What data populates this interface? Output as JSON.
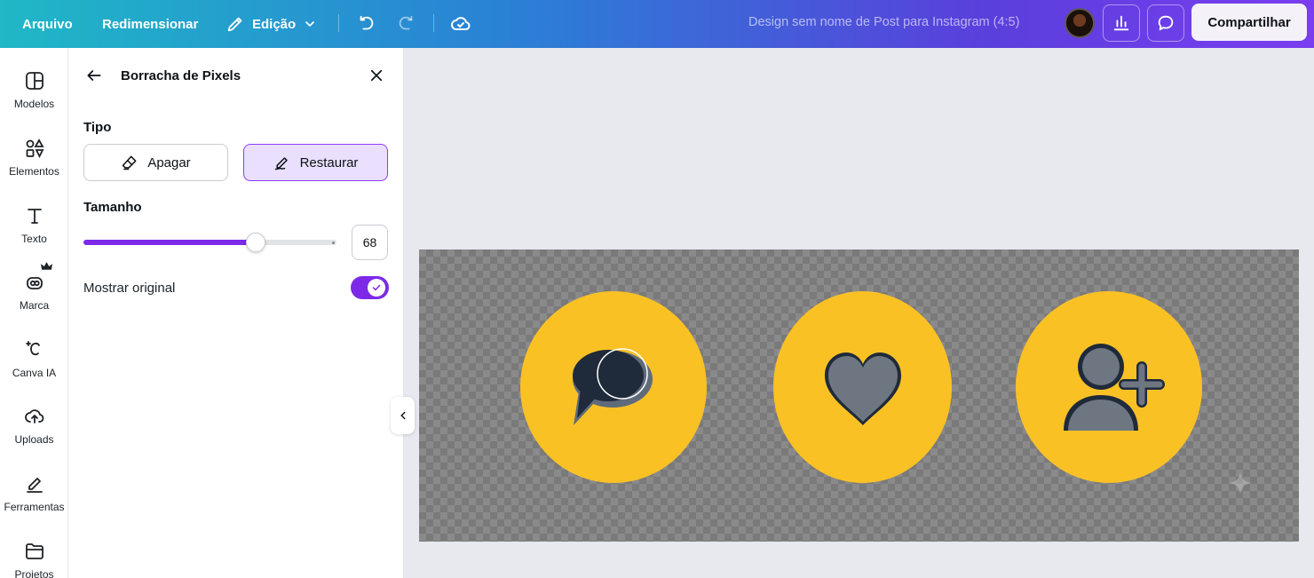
{
  "topbar": {
    "arquivo": "Arquivo",
    "redimensionar": "Redimensionar",
    "edicao": "Edição",
    "design_title": "Design sem nome de Post para Instagram (4:5)",
    "share": "Compartilhar"
  },
  "rail": {
    "items": [
      {
        "label": "Modelos",
        "icon": "templates-icon"
      },
      {
        "label": "Elementos",
        "icon": "elements-icon"
      },
      {
        "label": "Texto",
        "icon": "text-icon"
      },
      {
        "label": "Marca",
        "icon": "brand-icon"
      },
      {
        "label": "Canva IA",
        "icon": "magic-icon"
      },
      {
        "label": "Uploads",
        "icon": "upload-cloud-icon"
      },
      {
        "label": "Ferramentas",
        "icon": "tools-icon"
      },
      {
        "label": "Projetos",
        "icon": "folder-icon"
      }
    ]
  },
  "panel": {
    "title": "Borracha de Pixels",
    "type_label": "Tipo",
    "apagar": "Apagar",
    "restaurar": "Restaurar",
    "size_label": "Tamanho",
    "size_value": "68",
    "slider_fraction": 0.68,
    "show_original": "Mostrar original",
    "show_original_on": true
  },
  "colors": {
    "accent": "#7d2ae8",
    "selected_bg": "#eadffd",
    "circle": "#fac125",
    "icon_dark": "#1f2a3a"
  },
  "canvas": {
    "icons": [
      "chat-bubbles-icon",
      "heart-icon",
      "add-user-icon"
    ]
  }
}
